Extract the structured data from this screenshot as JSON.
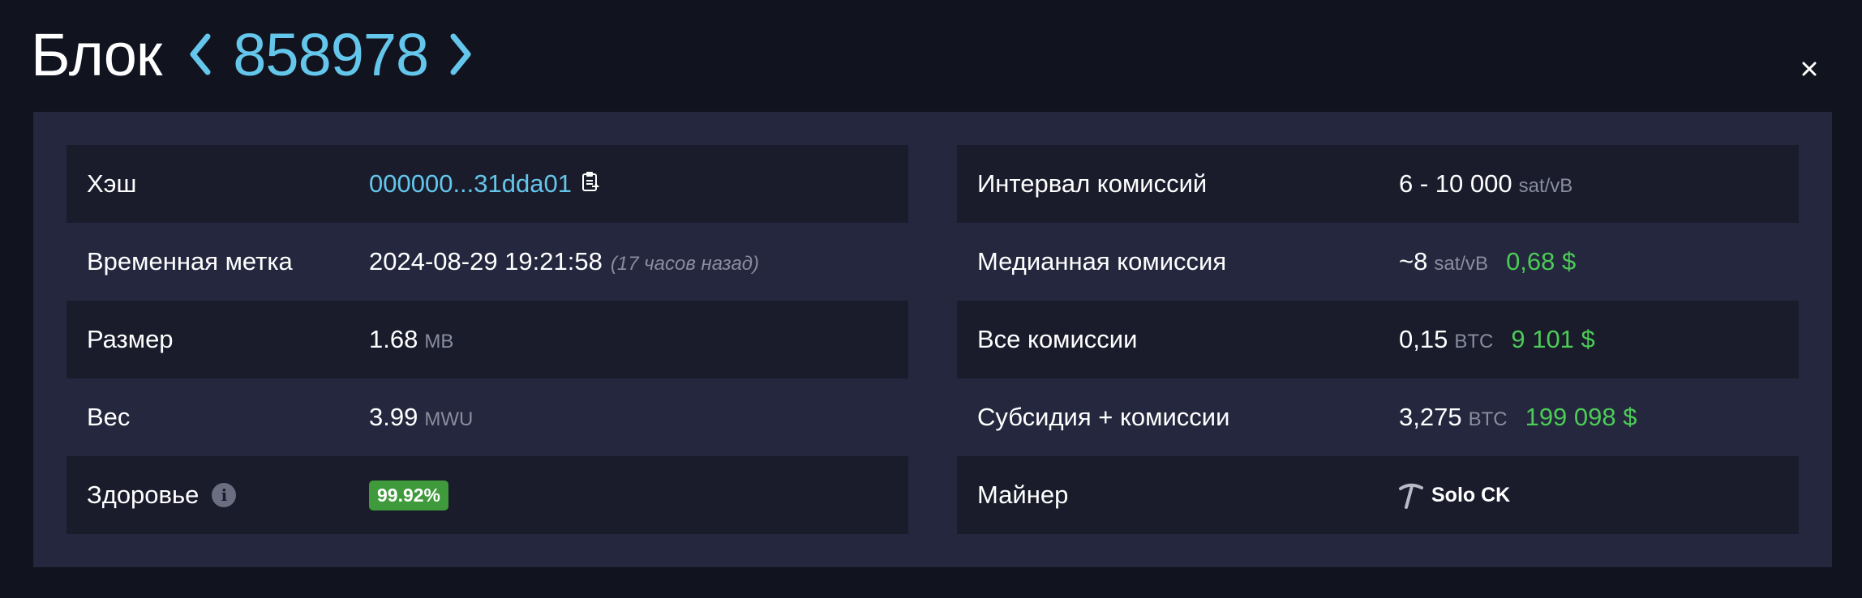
{
  "header": {
    "title": "Блок",
    "block_height": "858978"
  },
  "details_left": {
    "hash": {
      "label": "Хэш",
      "value": "000000...31dda01"
    },
    "timestamp": {
      "label": "Временная метка",
      "value": "2024-08-29 19:21:58",
      "relative": "(17 часов назад)"
    },
    "size": {
      "label": "Размер",
      "value": "1.68",
      "unit": "MB"
    },
    "weight": {
      "label": "Вес",
      "value": "3.99",
      "unit": "MWU"
    },
    "health": {
      "label": "Здоровье",
      "value": "99.92%"
    }
  },
  "details_right": {
    "fee_span": {
      "label": "Интервал комиссий",
      "value": "6 - 10 000",
      "unit": "sat/vB"
    },
    "median_fee": {
      "label": "Медианная комиссия",
      "value": "~8",
      "unit": "sat/vB",
      "fiat": "0,68 $"
    },
    "total_fees": {
      "label": "Все комиссии",
      "value": "0,15",
      "unit": "BTC",
      "fiat": "9 101 $"
    },
    "subsidy_fees": {
      "label": "Субсидия + комиссии",
      "value": "3,275",
      "unit": "BTC",
      "fiat": "199 098 $"
    },
    "miner": {
      "label": "Майнер",
      "value": "Solo CK"
    }
  },
  "icons": {
    "prev": "chevron-left-icon",
    "next": "chevron-right-icon",
    "close": "close-icon",
    "copy": "clipboard-icon",
    "info": "info-icon",
    "miner": "pickaxe-icon"
  },
  "colors": {
    "background": "#11131f",
    "card": "#24273e",
    "row_dark": "#1a1c2c",
    "accent": "#63c6ea",
    "fiat_green": "#4ccb56",
    "health_badge": "#3e9a3a",
    "muted": "#8a8d9f"
  }
}
